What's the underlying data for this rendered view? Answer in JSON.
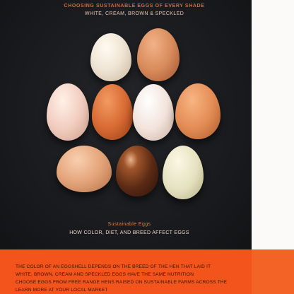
{
  "header": {
    "line1": "CHOOSING SUSTAINABLE EGGS OF EVERY SHADE",
    "line2": "WHITE, CREAM, BROWN & SPECKLED"
  },
  "caption": {
    "line1": "Sustainable Eggs",
    "line2": "HOW COLOR, DIET, AND BREED AFFECT EGGS"
  },
  "footer": {
    "line1": "THE COLOR OF AN EGGSHELL DEPENDS ON THE BREED OF THE HEN THAT LAID IT",
    "line2": "WHITE, BROWN, CREAM AND SPECKLED EGGS HAVE THE SAME NUTRITION",
    "line3": "CHOOSE EGGS FROM FREE RANGE HENS RAISED ON SUSTAINABLE FARMS ACROSS THE REGION",
    "line4": "LEARN MORE AT YOUR LOCAL MARKET"
  },
  "colors": {
    "background": "#18191c",
    "accent_orange": "#f2541b",
    "page": "#f6f3ee"
  },
  "eggs": [
    {
      "name": "cream",
      "color": "#f1e6d6"
    },
    {
      "name": "light-brown",
      "color": "#d98b5c"
    },
    {
      "name": "pinkish-white",
      "color": "#f2cdbf"
    },
    {
      "name": "orange-brown",
      "color": "#d86b34"
    },
    {
      "name": "white",
      "color": "#f3e4dc"
    },
    {
      "name": "tan-orange",
      "color": "#e58d56"
    },
    {
      "name": "peach",
      "color": "#e4a47a"
    },
    {
      "name": "dark-brown-glossy",
      "color": "#5a2a14"
    },
    {
      "name": "speckled-green",
      "color": "#e4e0bf"
    }
  ]
}
